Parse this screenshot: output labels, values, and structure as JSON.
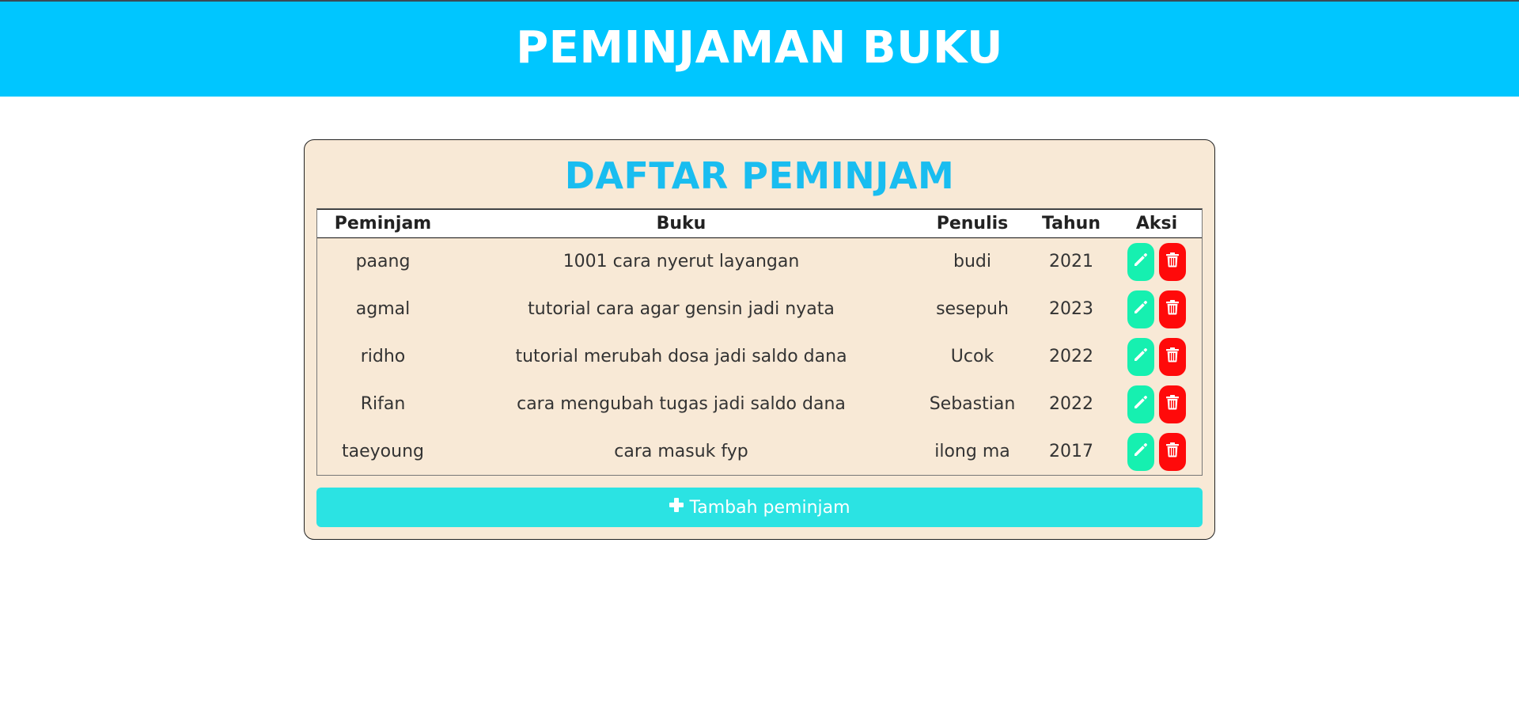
{
  "header": {
    "title": "PEMINJAMAN BUKU"
  },
  "card": {
    "title": "DAFTAR PEMINJAM",
    "columns": [
      "Peminjam",
      "Buku",
      "Penulis",
      "Tahun",
      "Aksi"
    ],
    "rows": [
      {
        "peminjam": "paang",
        "buku": "1001 cara nyerut layangan",
        "penulis": "budi",
        "tahun": "2021"
      },
      {
        "peminjam": "agmal",
        "buku": "tutorial cara agar gensin jadi nyata",
        "penulis": "sesepuh",
        "tahun": "2023"
      },
      {
        "peminjam": "ridho",
        "buku": "tutorial merubah dosa jadi saldo dana",
        "penulis": "Ucok",
        "tahun": "2022"
      },
      {
        "peminjam": "Rifan",
        "buku": "cara mengubah tugas jadi saldo dana",
        "penulis": "Sebastian",
        "tahun": "2022"
      },
      {
        "peminjam": "taeyoung",
        "buku": "cara masuk fyp",
        "penulis": "ilong ma",
        "tahun": "2017"
      }
    ],
    "add_button_label": "Tambah peminjam"
  },
  "icons": {
    "edit": "pencil-icon",
    "delete": "trash-icon",
    "add": "plus-icon"
  },
  "colors": {
    "header_bg": "#00c6ff",
    "title_blue": "#19bdf0",
    "card_bg": "#f8e9d6",
    "edit_btn": "#16f0b0",
    "delete_btn": "#ff0a0a",
    "add_btn": "#2be3e3"
  }
}
